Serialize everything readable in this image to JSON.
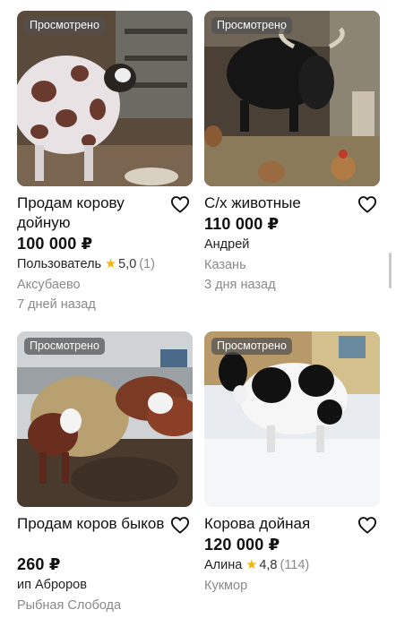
{
  "listings": [
    {
      "badge": "Просмотрено",
      "title": "Продам корову дойную",
      "price": "100 000 ₽",
      "seller": "Пользователь",
      "rating": "5,0",
      "rating_count": "(1)",
      "location": "Аксубаево",
      "date": "7 дней назад"
    },
    {
      "badge": "Просмотрено",
      "title": "С/х животные",
      "price": "110 000 ₽",
      "seller": "Андрей",
      "location": "Казань",
      "date": "3 дня назад"
    },
    {
      "badge": "Просмотрено",
      "title": "Продам коров быков",
      "price": "260 ₽",
      "seller": "ип Аброров",
      "location": "Рыбная Слобода"
    },
    {
      "badge": "Просмотрено",
      "title": "Корова дойная",
      "price": "120 000 ₽",
      "seller": "Алина",
      "rating": "4,8",
      "rating_count": "(114)",
      "location": "Кукмор"
    }
  ],
  "icons": {
    "favorite": "heart-outline-icon",
    "rating": "star-icon"
  },
  "colors": {
    "rating_star": "#f5b400",
    "secondary_text": "#8a8a8a",
    "badge_bg": "#505050"
  }
}
